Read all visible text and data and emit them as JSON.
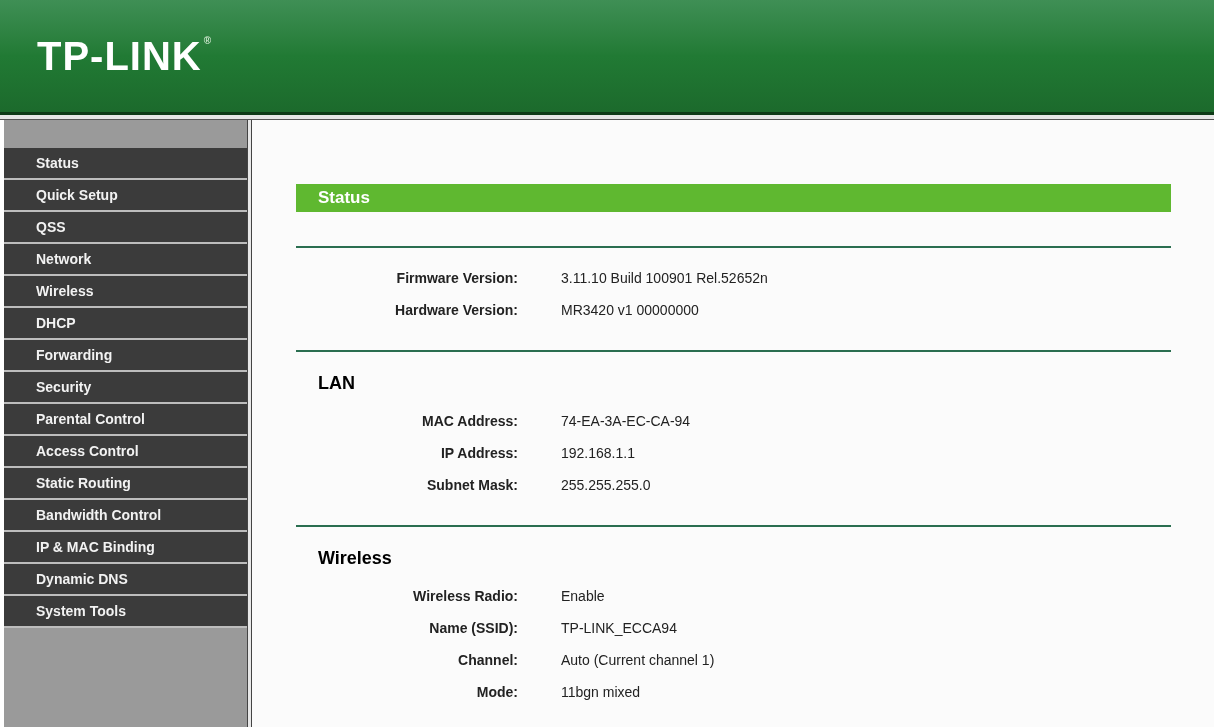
{
  "header": {
    "logo": "TP-LINK",
    "registered_mark": "®"
  },
  "sidebar": {
    "items": [
      {
        "label": "Status",
        "selected": false
      },
      {
        "label": "Quick Setup",
        "selected": false
      },
      {
        "label": "QSS",
        "selected": false
      },
      {
        "label": "Network",
        "selected": false
      },
      {
        "label": "Wireless",
        "selected": false
      },
      {
        "label": "DHCP",
        "selected": false
      },
      {
        "label": "Forwarding",
        "selected": false
      },
      {
        "label": "Security",
        "selected": false
      },
      {
        "label": "Parental Control",
        "selected": false
      },
      {
        "label": "Access Control",
        "selected": false
      },
      {
        "label": "Static Routing",
        "selected": false
      },
      {
        "label": "Bandwidth Control",
        "selected": false
      },
      {
        "label": "IP & MAC Binding",
        "selected": false
      },
      {
        "label": "Dynamic DNS",
        "selected": false
      },
      {
        "label": "System Tools",
        "selected": false
      }
    ]
  },
  "page_title": "Status",
  "sections": [
    {
      "rows": [
        {
          "label": "Firmware Version:",
          "value": "3.11.10 Build 100901 Rel.52652n"
        },
        {
          "label": "Hardware Version:",
          "value": "MR3420 v1 00000000"
        }
      ]
    },
    {
      "heading": "LAN",
      "rows": [
        {
          "label": "MAC Address:",
          "value": "74-EA-3A-EC-CA-94"
        },
        {
          "label": "IP Address:",
          "value": "192.168.1.1"
        },
        {
          "label": "Subnet Mask:",
          "value": "255.255.255.0"
        }
      ]
    },
    {
      "heading": "Wireless",
      "rows": [
        {
          "label": "Wireless Radio:",
          "value": "Enable"
        },
        {
          "label": "Name (SSID):",
          "value": "TP-LINK_ECCA94"
        },
        {
          "label": "Channel:",
          "value": "Auto (Current channel 1)"
        },
        {
          "label": "Mode:",
          "value": "11bgn mixed"
        }
      ]
    }
  ]
}
